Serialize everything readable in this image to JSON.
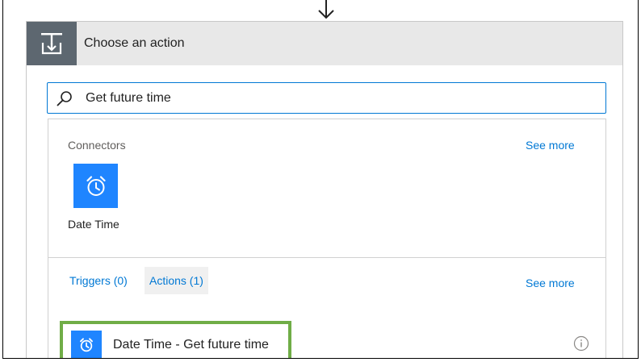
{
  "header": {
    "title": "Choose an action",
    "icon": "insert-step-icon"
  },
  "search": {
    "value": "Get future time",
    "icon": "search-icon"
  },
  "connectors": {
    "label": "Connectors",
    "see_more": "See more",
    "items": [
      {
        "label": "Date Time",
        "icon": "alarm-clock-icon"
      }
    ]
  },
  "tabs": {
    "triggers": "Triggers (0)",
    "actions": "Actions (1)",
    "see_more": "See more"
  },
  "actions": [
    {
      "label": "Date Time - Get future time",
      "icon": "alarm-clock-icon"
    }
  ],
  "colors": {
    "accent": "#0078d4",
    "tile_blue": "#1f85ff",
    "header_bg": "#e8e8e8",
    "header_icon_bg": "#5d6770",
    "highlight_border": "#70ad47"
  }
}
